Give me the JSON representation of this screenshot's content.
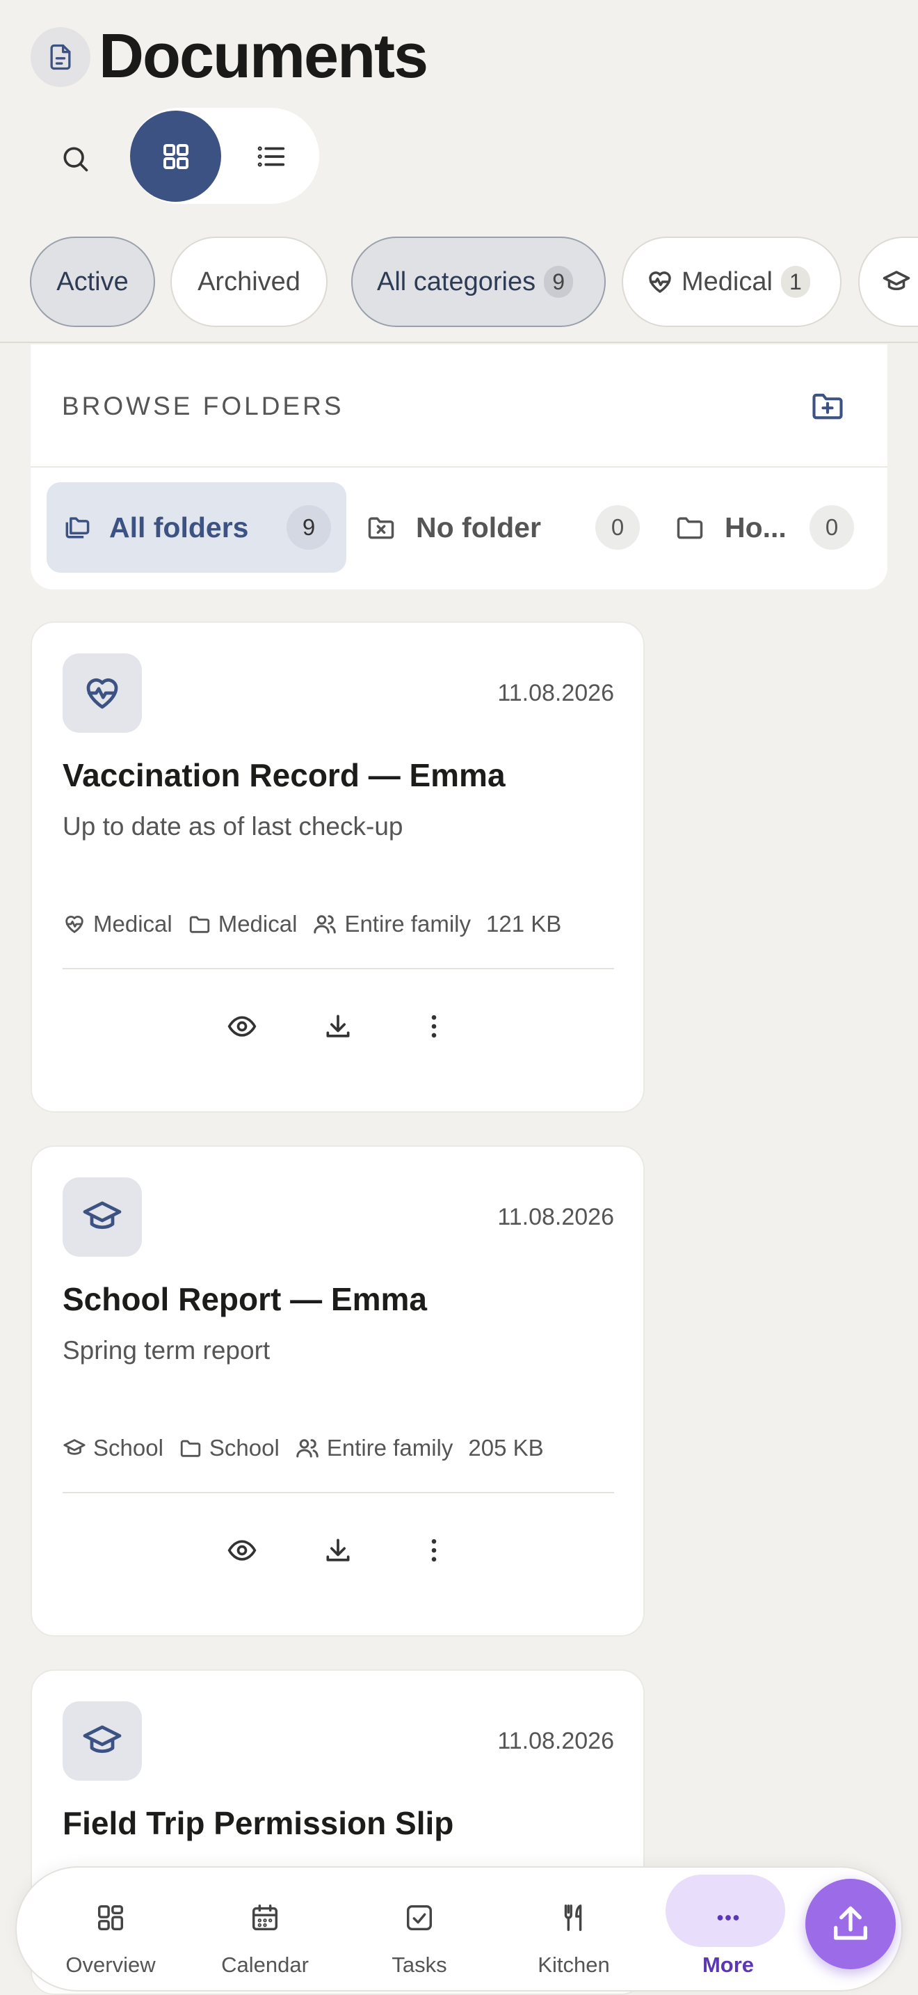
{
  "header": {
    "title": "Documents",
    "icon": "document-icon"
  },
  "toolbar": {
    "search_icon": "search-icon",
    "grid_icon": "grid-icon",
    "list_icon": "list-icon",
    "view_mode": "grid"
  },
  "filters": {
    "status": [
      "Active",
      "Archived"
    ],
    "selected_status": "Active",
    "categories": [
      {
        "label": "All categories",
        "count": "9",
        "selected": true
      },
      {
        "label": "Medical",
        "count": "1",
        "icon": "heart-pulse-icon"
      },
      {
        "label": "",
        "icon": "graduation-cap-icon"
      }
    ]
  },
  "folders": {
    "title": "BROWSE FOLDERS",
    "add_icon": "folder-plus-icon",
    "items": [
      {
        "label": "All folders",
        "count": "9",
        "selected": true
      },
      {
        "label": "No folder",
        "count": "0"
      },
      {
        "label": "Ho...",
        "count": "0"
      }
    ]
  },
  "documents": [
    {
      "title": "Vaccination Record — Emma",
      "description": "Up to date as of last check-up",
      "date": "11.08.2026",
      "category": "Medical",
      "folder": "Medical",
      "shared_with": "Entire family",
      "size": "121 KB",
      "icon": "heart-pulse-icon"
    },
    {
      "title": "School Report — Emma",
      "description": "Spring term report",
      "date": "11.08.2026",
      "category": "School",
      "folder": "School",
      "shared_with": "Entire family",
      "size": "205 KB",
      "icon": "graduation-cap-icon"
    },
    {
      "title": "Field Trip Permission Slip",
      "description": "",
      "date": "11.08.2026",
      "icon": "graduation-cap-icon"
    }
  ],
  "nav": {
    "items": [
      {
        "label": "Overview",
        "icon": "overview-icon"
      },
      {
        "label": "Calendar",
        "icon": "calendar-icon"
      },
      {
        "label": "Tasks",
        "icon": "tasks-icon"
      },
      {
        "label": "Kitchen",
        "icon": "kitchen-icon"
      },
      {
        "label": "More",
        "icon": "more-icon",
        "active": true
      }
    ],
    "upload_icon": "upload-icon"
  },
  "colors": {
    "accent": "#3b5283",
    "purple": "#9b6be8",
    "background": "#f2f1ed"
  }
}
